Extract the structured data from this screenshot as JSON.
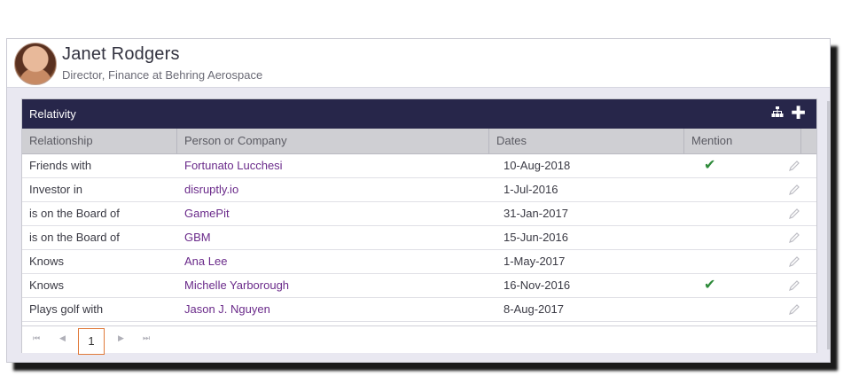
{
  "profile": {
    "name": "Janet Rodgers",
    "subtitle": "Director, Finance at Behring Aerospace"
  },
  "grid": {
    "title": "Relativity",
    "toolbar_icons": [
      "org-chart-icon",
      "plus-icon"
    ],
    "columns": [
      "Relationship",
      "Person or Company",
      "Dates",
      "Mention"
    ],
    "rows": [
      {
        "relationship": "Friends with",
        "person": "Fortunato Lucchesi",
        "date": "10-Aug-2018",
        "mention": "✔"
      },
      {
        "relationship": "Investor in",
        "person": "disruptly.io",
        "date": "1-Jul-2016",
        "mention": ""
      },
      {
        "relationship": "is on the Board of",
        "person": "GamePit",
        "date": "31-Jan-2017",
        "mention": ""
      },
      {
        "relationship": "is on the Board of",
        "person": "GBM",
        "date": "15-Jun-2016",
        "mention": ""
      },
      {
        "relationship": "Knows",
        "person": "Ana Lee",
        "date": "1-May-2017",
        "mention": ""
      },
      {
        "relationship": "Knows",
        "person": "Michelle Yarborough",
        "date": "16-Nov-2016",
        "mention": "✔"
      },
      {
        "relationship": "Plays golf with",
        "person": "Jason J. Nguyen",
        "date": "8-Aug-2017",
        "mention": ""
      }
    ]
  },
  "pager": {
    "first": "⏮",
    "prev": "◀",
    "current": "1",
    "next": "▶",
    "last": "⏭"
  },
  "colors": {
    "titlebar": "#27264a",
    "link": "#6a2a8a",
    "check": "#2e8b3a",
    "pager_active_border": "#e07a3a"
  }
}
